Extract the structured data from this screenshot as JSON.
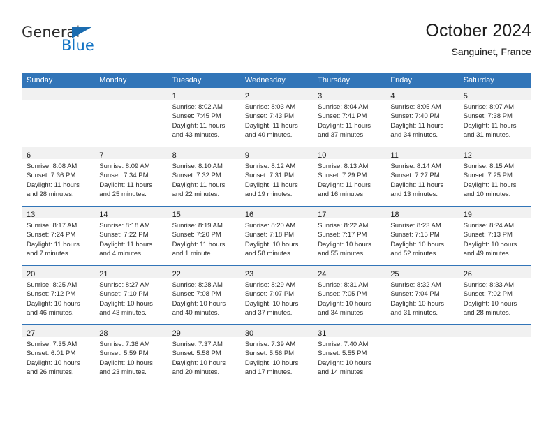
{
  "brand": {
    "name_part1": "General",
    "name_part2": "Blue",
    "accent_color": "#1273c4",
    "triangle_color": "#1b6cb0"
  },
  "header": {
    "title": "October 2024",
    "subtitle": "Sanguinet, France"
  },
  "calendar": {
    "header_color": "#3275b8",
    "daynum_band_color": "#f1f1f1",
    "weekday_headers": [
      "Sunday",
      "Monday",
      "Tuesday",
      "Wednesday",
      "Thursday",
      "Friday",
      "Saturday"
    ],
    "weeks": [
      [
        {
          "day": "",
          "lines": []
        },
        {
          "day": "",
          "lines": []
        },
        {
          "day": "1",
          "lines": [
            "Sunrise: 8:02 AM",
            "Sunset: 7:45 PM",
            "Daylight: 11 hours",
            "and 43 minutes."
          ]
        },
        {
          "day": "2",
          "lines": [
            "Sunrise: 8:03 AM",
            "Sunset: 7:43 PM",
            "Daylight: 11 hours",
            "and 40 minutes."
          ]
        },
        {
          "day": "3",
          "lines": [
            "Sunrise: 8:04 AM",
            "Sunset: 7:41 PM",
            "Daylight: 11 hours",
            "and 37 minutes."
          ]
        },
        {
          "day": "4",
          "lines": [
            "Sunrise: 8:05 AM",
            "Sunset: 7:40 PM",
            "Daylight: 11 hours",
            "and 34 minutes."
          ]
        },
        {
          "day": "5",
          "lines": [
            "Sunrise: 8:07 AM",
            "Sunset: 7:38 PM",
            "Daylight: 11 hours",
            "and 31 minutes."
          ]
        }
      ],
      [
        {
          "day": "6",
          "lines": [
            "Sunrise: 8:08 AM",
            "Sunset: 7:36 PM",
            "Daylight: 11 hours",
            "and 28 minutes."
          ]
        },
        {
          "day": "7",
          "lines": [
            "Sunrise: 8:09 AM",
            "Sunset: 7:34 PM",
            "Daylight: 11 hours",
            "and 25 minutes."
          ]
        },
        {
          "day": "8",
          "lines": [
            "Sunrise: 8:10 AM",
            "Sunset: 7:32 PM",
            "Daylight: 11 hours",
            "and 22 minutes."
          ]
        },
        {
          "day": "9",
          "lines": [
            "Sunrise: 8:12 AM",
            "Sunset: 7:31 PM",
            "Daylight: 11 hours",
            "and 19 minutes."
          ]
        },
        {
          "day": "10",
          "lines": [
            "Sunrise: 8:13 AM",
            "Sunset: 7:29 PM",
            "Daylight: 11 hours",
            "and 16 minutes."
          ]
        },
        {
          "day": "11",
          "lines": [
            "Sunrise: 8:14 AM",
            "Sunset: 7:27 PM",
            "Daylight: 11 hours",
            "and 13 minutes."
          ]
        },
        {
          "day": "12",
          "lines": [
            "Sunrise: 8:15 AM",
            "Sunset: 7:25 PM",
            "Daylight: 11 hours",
            "and 10 minutes."
          ]
        }
      ],
      [
        {
          "day": "13",
          "lines": [
            "Sunrise: 8:17 AM",
            "Sunset: 7:24 PM",
            "Daylight: 11 hours",
            "and 7 minutes."
          ]
        },
        {
          "day": "14",
          "lines": [
            "Sunrise: 8:18 AM",
            "Sunset: 7:22 PM",
            "Daylight: 11 hours",
            "and 4 minutes."
          ]
        },
        {
          "day": "15",
          "lines": [
            "Sunrise: 8:19 AM",
            "Sunset: 7:20 PM",
            "Daylight: 11 hours",
            "and 1 minute."
          ]
        },
        {
          "day": "16",
          "lines": [
            "Sunrise: 8:20 AM",
            "Sunset: 7:18 PM",
            "Daylight: 10 hours",
            "and 58 minutes."
          ]
        },
        {
          "day": "17",
          "lines": [
            "Sunrise: 8:22 AM",
            "Sunset: 7:17 PM",
            "Daylight: 10 hours",
            "and 55 minutes."
          ]
        },
        {
          "day": "18",
          "lines": [
            "Sunrise: 8:23 AM",
            "Sunset: 7:15 PM",
            "Daylight: 10 hours",
            "and 52 minutes."
          ]
        },
        {
          "day": "19",
          "lines": [
            "Sunrise: 8:24 AM",
            "Sunset: 7:13 PM",
            "Daylight: 10 hours",
            "and 49 minutes."
          ]
        }
      ],
      [
        {
          "day": "20",
          "lines": [
            "Sunrise: 8:25 AM",
            "Sunset: 7:12 PM",
            "Daylight: 10 hours",
            "and 46 minutes."
          ]
        },
        {
          "day": "21",
          "lines": [
            "Sunrise: 8:27 AM",
            "Sunset: 7:10 PM",
            "Daylight: 10 hours",
            "and 43 minutes."
          ]
        },
        {
          "day": "22",
          "lines": [
            "Sunrise: 8:28 AM",
            "Sunset: 7:08 PM",
            "Daylight: 10 hours",
            "and 40 minutes."
          ]
        },
        {
          "day": "23",
          "lines": [
            "Sunrise: 8:29 AM",
            "Sunset: 7:07 PM",
            "Daylight: 10 hours",
            "and 37 minutes."
          ]
        },
        {
          "day": "24",
          "lines": [
            "Sunrise: 8:31 AM",
            "Sunset: 7:05 PM",
            "Daylight: 10 hours",
            "and 34 minutes."
          ]
        },
        {
          "day": "25",
          "lines": [
            "Sunrise: 8:32 AM",
            "Sunset: 7:04 PM",
            "Daylight: 10 hours",
            "and 31 minutes."
          ]
        },
        {
          "day": "26",
          "lines": [
            "Sunrise: 8:33 AM",
            "Sunset: 7:02 PM",
            "Daylight: 10 hours",
            "and 28 minutes."
          ]
        }
      ],
      [
        {
          "day": "27",
          "lines": [
            "Sunrise: 7:35 AM",
            "Sunset: 6:01 PM",
            "Daylight: 10 hours",
            "and 26 minutes."
          ]
        },
        {
          "day": "28",
          "lines": [
            "Sunrise: 7:36 AM",
            "Sunset: 5:59 PM",
            "Daylight: 10 hours",
            "and 23 minutes."
          ]
        },
        {
          "day": "29",
          "lines": [
            "Sunrise: 7:37 AM",
            "Sunset: 5:58 PM",
            "Daylight: 10 hours",
            "and 20 minutes."
          ]
        },
        {
          "day": "30",
          "lines": [
            "Sunrise: 7:39 AM",
            "Sunset: 5:56 PM",
            "Daylight: 10 hours",
            "and 17 minutes."
          ]
        },
        {
          "day": "31",
          "lines": [
            "Sunrise: 7:40 AM",
            "Sunset: 5:55 PM",
            "Daylight: 10 hours",
            "and 14 minutes."
          ]
        },
        {
          "day": "",
          "lines": []
        },
        {
          "day": "",
          "lines": []
        }
      ]
    ]
  }
}
